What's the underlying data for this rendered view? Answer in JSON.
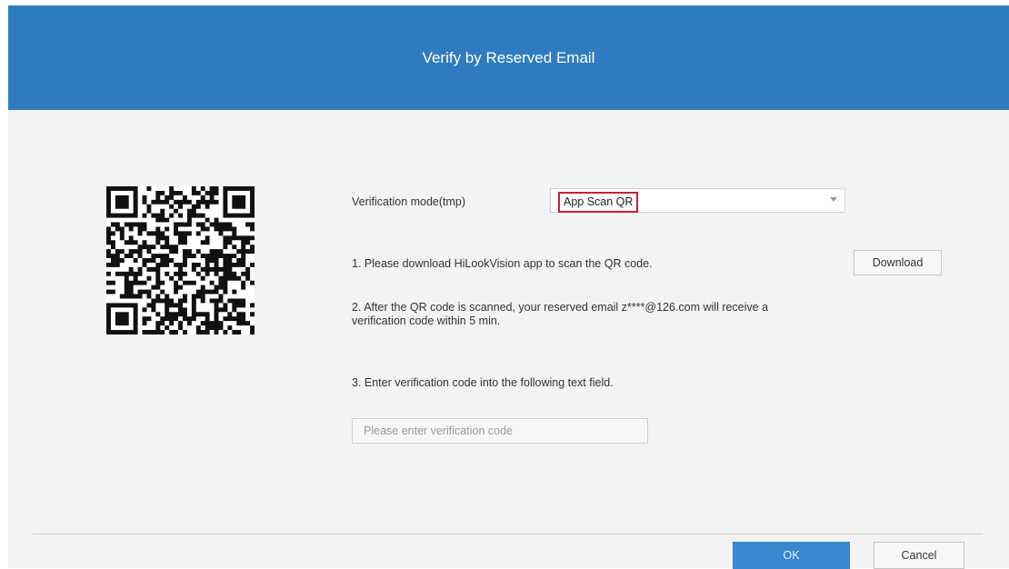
{
  "dialog": {
    "title": "Verify by Reserved Email"
  },
  "qr": {
    "icon": "qr-code"
  },
  "verification_mode": {
    "label": "Verification mode(tmp)",
    "selected": "App Scan QR",
    "highlight_color": "#d0202a"
  },
  "steps": {
    "step1": "1. Please download HiLookVision app to scan the QR code.",
    "step2_line1": "2. After the QR code is scanned, your reserved email z****@126.com will receive a",
    "step2_line2": "verification code within 5 min.",
    "step3": "3. Enter verification code into the following text field."
  },
  "download_button": "Download",
  "code_input": {
    "placeholder": "Please enter verification code",
    "value": ""
  },
  "footer": {
    "ok": "OK",
    "cancel": "Cancel"
  },
  "colors": {
    "header": "#2f7bbf",
    "primary_button": "#3a86d0",
    "background": "#f3f3f3"
  }
}
